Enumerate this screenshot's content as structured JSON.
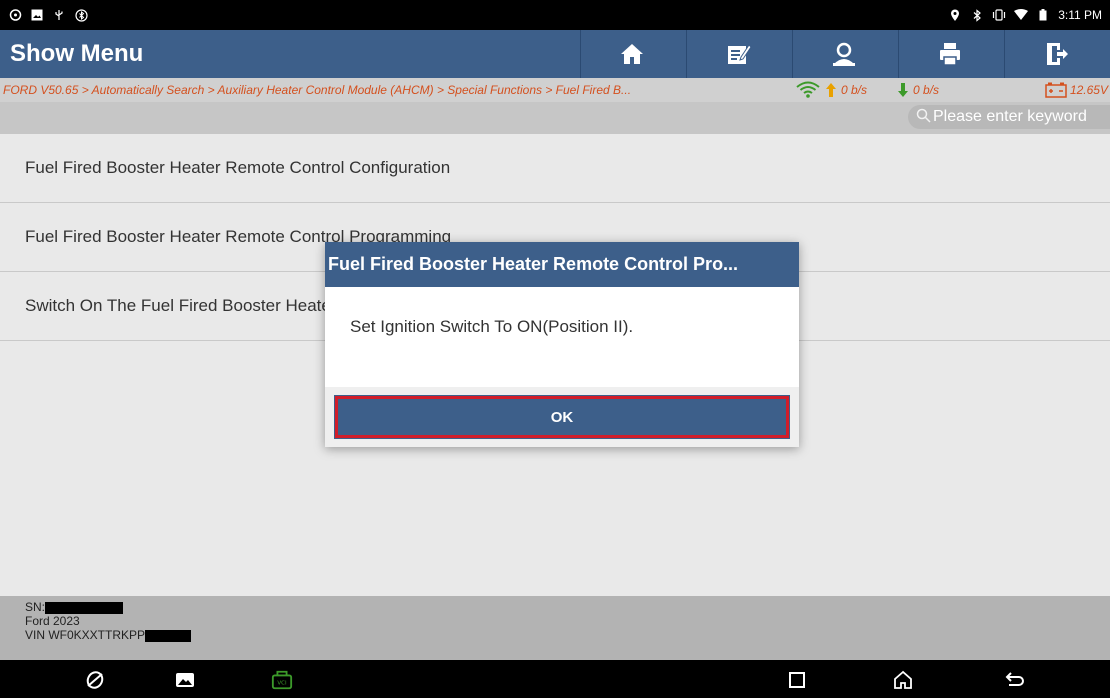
{
  "status_bar": {
    "time": "3:11 PM",
    "left_icons": [
      "chat-icon",
      "image-icon",
      "usb-icon",
      "bluetooth-icon"
    ],
    "right_icons": [
      "location-icon",
      "bluetooth-icon",
      "vibrate-icon",
      "wifi-icon",
      "battery-icon"
    ]
  },
  "header": {
    "title": "Show Menu",
    "toolbar": [
      "home-icon",
      "edit-icon",
      "user-icon",
      "print-icon",
      "exit-icon"
    ],
    "bg_color": "#3d5f8a"
  },
  "breadcrumb": {
    "path": "FORD V50.65 > Automatically Search > Auxiliary Heater Control Module (AHCM) > Special Functions > Fuel Fired B...",
    "upload_rate": "0 b/s",
    "download_rate": "0 b/s",
    "voltage": "12.65V"
  },
  "search": {
    "placeholder": "Please enter keyword"
  },
  "menu": {
    "items": [
      "Fuel Fired Booster Heater Remote Control Configuration",
      "Fuel Fired Booster Heater Remote Control Programming",
      "Switch On The Fuel Fired Booster Heater"
    ]
  },
  "footer": {
    "sn_label": "SN:",
    "vehicle": "Ford  2023",
    "vin_label": "VIN WF0KXXTTRKPP"
  },
  "dialog": {
    "title": "Fuel Fired Booster Heater Remote Control Pro...",
    "message": "Set Ignition Switch To ON(Position II).",
    "ok_label": "OK",
    "highlight_color": "#d11d2a"
  },
  "nav_bar": {
    "icons": [
      "browser-icon",
      "gallery-icon",
      "vci-icon",
      "recents-icon",
      "home-icon",
      "back-icon"
    ]
  }
}
